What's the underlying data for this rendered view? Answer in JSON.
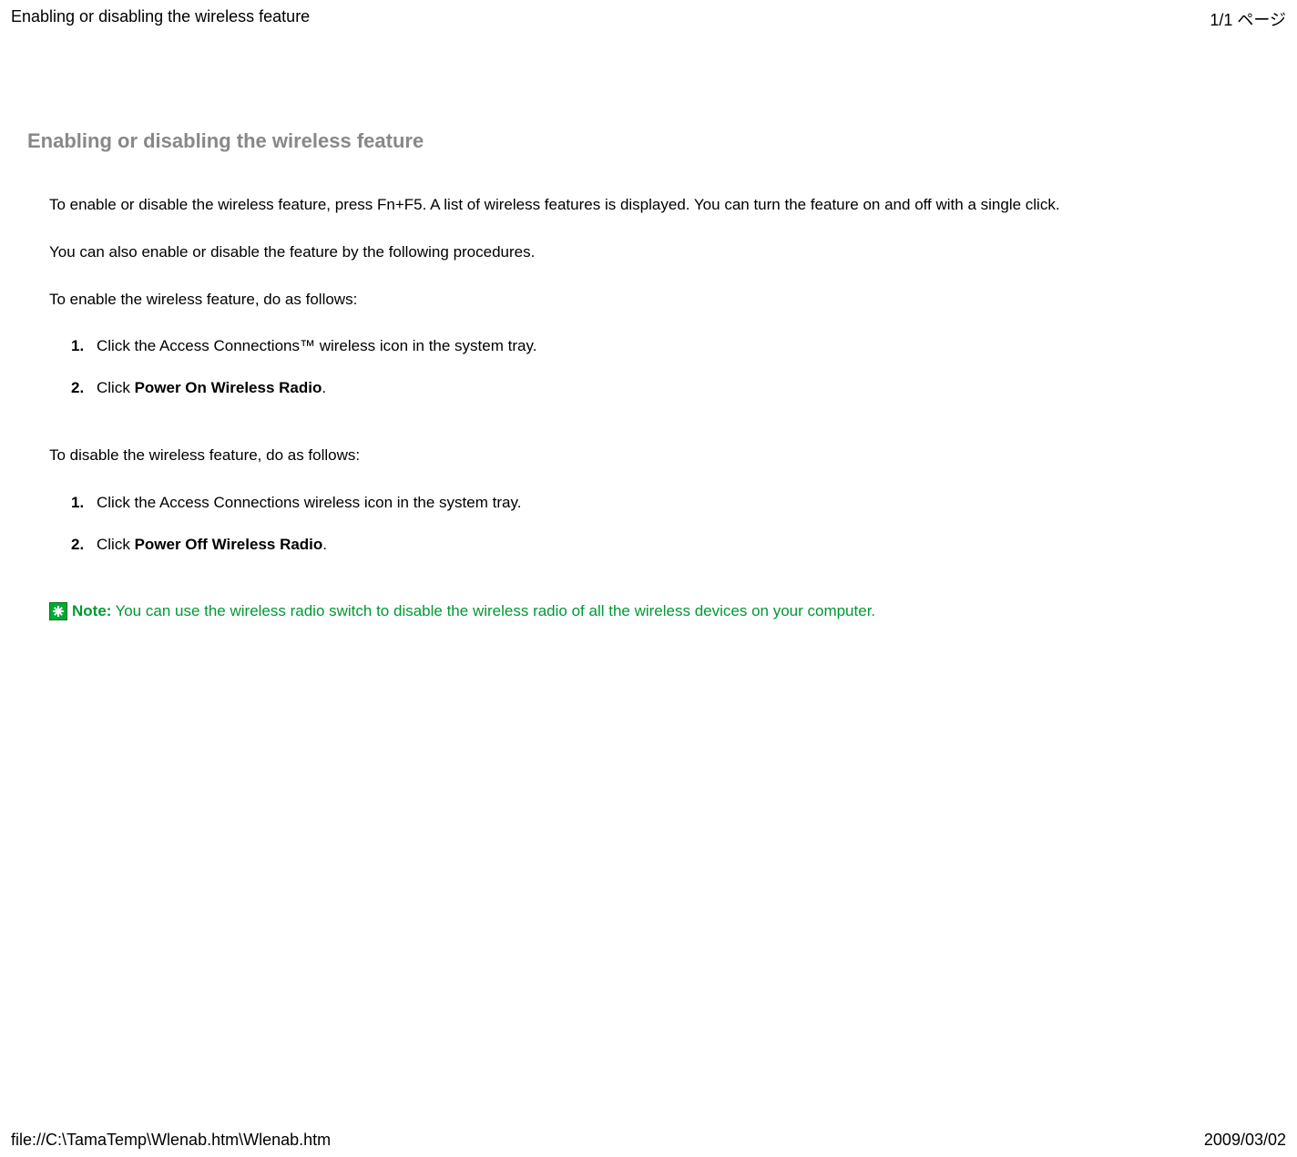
{
  "header": {
    "title": "Enabling or disabling the wireless feature",
    "page_info": "1/1 ページ"
  },
  "main": {
    "title": "Enabling or disabling the wireless feature",
    "intro1": "To enable or disable the wireless feature, press Fn+F5. A list of wireless features is displayed. You can turn the feature on and off with a single click.",
    "intro2": "You can also enable or disable the feature by the following procedures.",
    "enable_heading": "To enable the wireless feature, do as follows:",
    "enable_steps": {
      "n1": "1.",
      "t1": "Click the Access Connections™ wireless icon in the system tray.",
      "n2": "2.",
      "t2a": "Click ",
      "t2b": "Power On Wireless Radio",
      "t2c": "."
    },
    "disable_heading": "To disable the wireless feature, do as follows:",
    "disable_steps": {
      "n1": "1.",
      "t1": "Click the Access Connections wireless icon in the system tray.",
      "n2": "2.",
      "t2a": "Click ",
      "t2b": "Power Off Wireless Radio",
      "t2c": "."
    },
    "note": {
      "label": "Note:",
      "text": " You can use the wireless radio switch to disable the wireless radio of all the wireless devices on your computer."
    }
  },
  "footer": {
    "path": "file://C:\\TamaTemp\\Wlenab.htm\\Wlenab.htm",
    "date": "2009/03/02"
  }
}
